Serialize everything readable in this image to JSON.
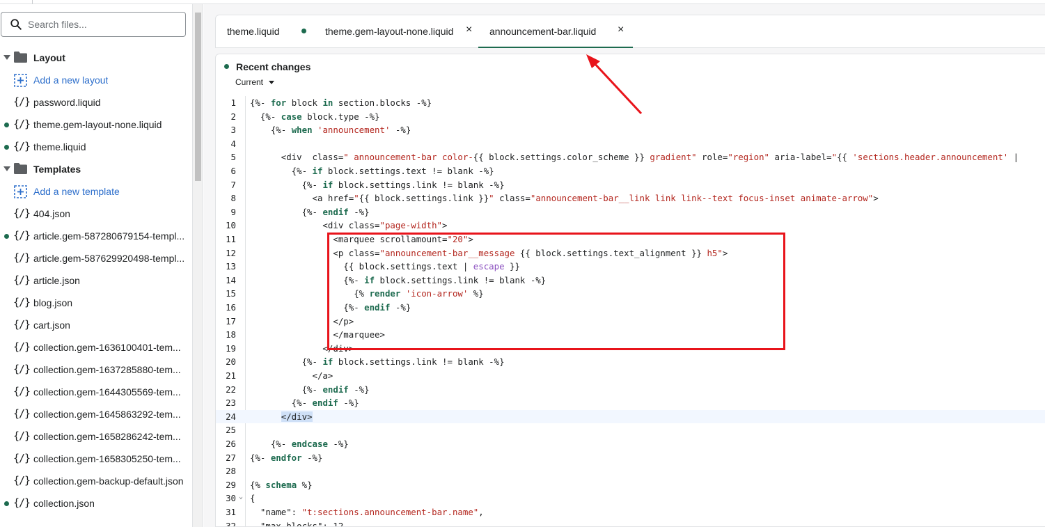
{
  "sidebar": {
    "search_placeholder": "Search files...",
    "items": [
      {
        "type": "group",
        "label": "Layout",
        "modified": false
      },
      {
        "type": "add",
        "label": "Add a new layout",
        "modified": false
      },
      {
        "type": "file",
        "icon": "{/}",
        "label": "password.liquid",
        "modified": false
      },
      {
        "type": "file",
        "icon": "{/}",
        "label": "theme.gem-layout-none.liquid",
        "modified": true
      },
      {
        "type": "file",
        "icon": "{/}",
        "label": "theme.liquid",
        "modified": true
      },
      {
        "type": "group",
        "label": "Templates",
        "modified": false
      },
      {
        "type": "add",
        "label": "Add a new template",
        "modified": false
      },
      {
        "type": "file",
        "icon": "{/}",
        "label": "404.json",
        "modified": false
      },
      {
        "type": "file",
        "icon": "{/}",
        "label": "article.gem-587280679154-templ...",
        "modified": true
      },
      {
        "type": "file",
        "icon": "{/}",
        "label": "article.gem-587629920498-templ...",
        "modified": false
      },
      {
        "type": "file",
        "icon": "{/}",
        "label": "article.json",
        "modified": false
      },
      {
        "type": "file",
        "icon": "{/}",
        "label": "blog.json",
        "modified": false
      },
      {
        "type": "file",
        "icon": "{/}",
        "label": "cart.json",
        "modified": false
      },
      {
        "type": "file",
        "icon": "{/}",
        "label": "collection.gem-1636100401-tem...",
        "modified": false
      },
      {
        "type": "file",
        "icon": "{/}",
        "label": "collection.gem-1637285880-tem...",
        "modified": false
      },
      {
        "type": "file",
        "icon": "{/}",
        "label": "collection.gem-1644305569-tem...",
        "modified": false
      },
      {
        "type": "file",
        "icon": "{/}",
        "label": "collection.gem-1645863292-tem...",
        "modified": false
      },
      {
        "type": "file",
        "icon": "{/}",
        "label": "collection.gem-1658286242-tem...",
        "modified": false
      },
      {
        "type": "file",
        "icon": "{/}",
        "label": "collection.gem-1658305250-tem...",
        "modified": false
      },
      {
        "type": "file",
        "icon": "{/}",
        "label": "collection.gem-backup-default.json",
        "modified": false
      },
      {
        "type": "file",
        "icon": "{/}",
        "label": "collection.json",
        "modified": true
      }
    ]
  },
  "tabs": [
    {
      "label": "theme.liquid",
      "modified": true,
      "closable": false,
      "active": false
    },
    {
      "label": "theme.gem-layout-none.liquid",
      "modified": false,
      "closable": true,
      "active": false
    },
    {
      "label": "announcement-bar.liquid",
      "modified": false,
      "closable": true,
      "active": true
    }
  ],
  "tab_close_glyph": "×",
  "recent_changes": {
    "title": "Recent changes",
    "version": "Current"
  },
  "code_lines": [
    {
      "n": "1",
      "t": [
        [
          "{%- ",
          ""
        ],
        [
          "for",
          "k"
        ],
        [
          " block ",
          ""
        ],
        [
          "in",
          "k"
        ],
        [
          " section.blocks -%}",
          ""
        ]
      ]
    },
    {
      "n": "2",
      "t": [
        [
          "  {%- ",
          ""
        ],
        [
          "case",
          "k"
        ],
        [
          " block.type -%}",
          ""
        ]
      ]
    },
    {
      "n": "3",
      "t": [
        [
          "    {%- ",
          ""
        ],
        [
          "when",
          "k"
        ],
        [
          " ",
          ""
        ],
        [
          "'announcement'",
          "s"
        ],
        [
          " -%}",
          ""
        ]
      ]
    },
    {
      "n": "4",
      "t": [
        [
          "",
          ""
        ]
      ]
    },
    {
      "n": "5",
      "t": [
        [
          "      <div  class=",
          ""
        ],
        [
          "\" announcement-bar color-",
          "s"
        ],
        [
          "{{ block.settings.color_scheme }}",
          ""
        ],
        [
          " gradient\"",
          "s"
        ],
        [
          " role=",
          ""
        ],
        [
          "\"region\"",
          "s"
        ],
        [
          " aria-label=",
          ""
        ],
        [
          "\"",
          "s"
        ],
        [
          "{{ ",
          ""
        ],
        [
          "'sections.header.announcement'",
          "s"
        ],
        [
          " |",
          ""
        ]
      ]
    },
    {
      "n": "6",
      "t": [
        [
          "        {%- ",
          ""
        ],
        [
          "if",
          "k"
        ],
        [
          " block.settings.text != blank -%}",
          ""
        ]
      ]
    },
    {
      "n": "7",
      "t": [
        [
          "          {%- ",
          ""
        ],
        [
          "if",
          "k"
        ],
        [
          " block.settings.link != blank -%}",
          ""
        ]
      ]
    },
    {
      "n": "8",
      "t": [
        [
          "            <a href=",
          ""
        ],
        [
          "\"",
          "s"
        ],
        [
          "{{ block.settings.link }}",
          ""
        ],
        [
          "\"",
          "s"
        ],
        [
          " class=",
          ""
        ],
        [
          "\"announcement-bar__link link link--text focus-inset animate-arrow\"",
          "s"
        ],
        [
          ">",
          ""
        ]
      ]
    },
    {
      "n": "9",
      "t": [
        [
          "          {%- ",
          ""
        ],
        [
          "endif",
          "k"
        ],
        [
          " -%}",
          ""
        ]
      ]
    },
    {
      "n": "10",
      "t": [
        [
          "              <div class=",
          ""
        ],
        [
          "\"page-width\"",
          "s"
        ],
        [
          ">",
          ""
        ]
      ]
    },
    {
      "n": "11",
      "t": [
        [
          "                <marquee scrollamount=",
          ""
        ],
        [
          "\"20\"",
          "s"
        ],
        [
          ">",
          ""
        ]
      ]
    },
    {
      "n": "12",
      "t": [
        [
          "                <p class=",
          ""
        ],
        [
          "\"announcement-bar__message ",
          "s"
        ],
        [
          "{{ block.settings.text_alignment }}",
          ""
        ],
        [
          " h5\"",
          "s"
        ],
        [
          ">",
          ""
        ]
      ]
    },
    {
      "n": "13",
      "t": [
        [
          "                  {{ block.settings.text | ",
          ""
        ],
        [
          "escape",
          "p"
        ],
        [
          " }}",
          ""
        ]
      ]
    },
    {
      "n": "14",
      "t": [
        [
          "                  {%- ",
          ""
        ],
        [
          "if",
          "k"
        ],
        [
          " block.settings.link != blank -%}",
          ""
        ]
      ]
    },
    {
      "n": "15",
      "t": [
        [
          "                    {% ",
          ""
        ],
        [
          "render",
          "k"
        ],
        [
          " ",
          ""
        ],
        [
          "'icon-arrow'",
          "s"
        ],
        [
          " %}",
          ""
        ]
      ]
    },
    {
      "n": "16",
      "t": [
        [
          "                  {%- ",
          ""
        ],
        [
          "endif",
          "k"
        ],
        [
          " -%}",
          ""
        ]
      ]
    },
    {
      "n": "17",
      "t": [
        [
          "                </p>",
          ""
        ]
      ]
    },
    {
      "n": "18",
      "t": [
        [
          "                </marquee>",
          ""
        ]
      ]
    },
    {
      "n": "19",
      "t": [
        [
          "              </div>",
          ""
        ]
      ]
    },
    {
      "n": "20",
      "t": [
        [
          "          {%- ",
          ""
        ],
        [
          "if",
          "k"
        ],
        [
          " block.settings.link != blank -%}",
          ""
        ]
      ]
    },
    {
      "n": "21",
      "t": [
        [
          "            </a>",
          ""
        ]
      ]
    },
    {
      "n": "22",
      "t": [
        [
          "          {%- ",
          ""
        ],
        [
          "endif",
          "k"
        ],
        [
          " -%}",
          ""
        ]
      ]
    },
    {
      "n": "23",
      "t": [
        [
          "        {%- ",
          ""
        ],
        [
          "endif",
          "k"
        ],
        [
          " -%}",
          ""
        ]
      ]
    },
    {
      "n": "24",
      "t": [
        [
          "      ",
          ""
        ],
        [
          "</div>",
          "sel"
        ]
      ],
      "current": true
    },
    {
      "n": "25",
      "t": [
        [
          "",
          ""
        ]
      ]
    },
    {
      "n": "26",
      "t": [
        [
          "    {%- ",
          ""
        ],
        [
          "endcase",
          "k"
        ],
        [
          " -%}",
          ""
        ]
      ]
    },
    {
      "n": "27",
      "t": [
        [
          "{%- ",
          ""
        ],
        [
          "endfor",
          "k"
        ],
        [
          " -%}",
          ""
        ]
      ]
    },
    {
      "n": "28",
      "t": [
        [
          "",
          ""
        ]
      ]
    },
    {
      "n": "29",
      "t": [
        [
          "{% ",
          ""
        ],
        [
          "schema",
          "k"
        ],
        [
          " %}",
          ""
        ]
      ]
    },
    {
      "n": "30",
      "t": [
        [
          "{",
          ""
        ]
      ],
      "fold": "⌄"
    },
    {
      "n": "31",
      "t": [
        [
          "  \"name\": ",
          ""
        ],
        [
          "\"t:sections.announcement-bar.name\"",
          "s"
        ],
        [
          ",",
          ""
        ]
      ]
    },
    {
      "n": "32",
      "t": [
        [
          "  \"max_blocks\": 12,",
          ""
        ]
      ]
    }
  ]
}
